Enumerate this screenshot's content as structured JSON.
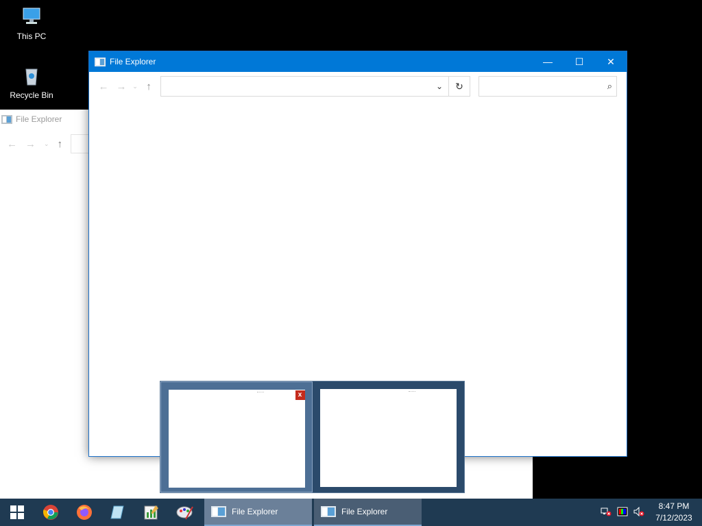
{
  "desktop": {
    "icons": [
      {
        "label": "This PC"
      },
      {
        "label": "Recycle Bin"
      }
    ]
  },
  "back_window": {
    "title": "File Explorer"
  },
  "front_window": {
    "title": "File Explorer",
    "controls": {
      "minimize": "—",
      "maximize": "☐",
      "close": "✕"
    },
    "nav": {
      "back": "←",
      "forward": "→",
      "recent": "⌄",
      "up": "↑"
    },
    "address": {
      "value": "",
      "dropdown": "⌄",
      "refresh": "↻"
    },
    "search": {
      "placeholder": "",
      "icon": "⌕"
    }
  },
  "preview": {
    "close_label": "x"
  },
  "taskbar": {
    "pinned": [
      "start-icon",
      "chrome-icon",
      "firefox-icon",
      "notepad-icon",
      "chart-app-icon",
      "paint-icon"
    ],
    "tasks": [
      {
        "label": "File Explorer",
        "active": true
      },
      {
        "label": "File Explorer",
        "active": false
      }
    ],
    "tray": {
      "time": "8:47 PM",
      "date": "7/12/2023"
    }
  },
  "colors": {
    "titlebar": "#0078d7",
    "taskbar": "#1f3a52",
    "close_red": "#c42b1c"
  }
}
